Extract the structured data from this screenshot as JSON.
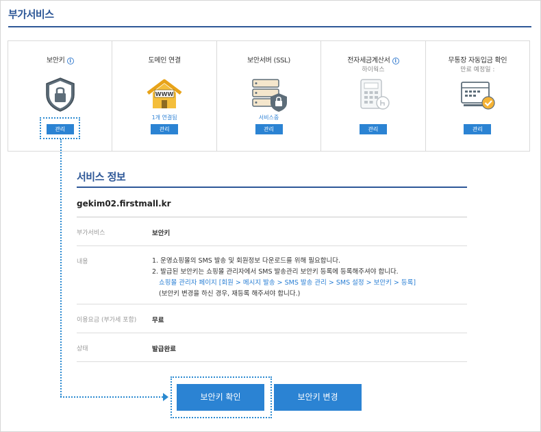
{
  "page": {
    "title": "부가서비스"
  },
  "cards": [
    {
      "title": "보안키",
      "info_icon": "i",
      "subtitle": "",
      "status": "",
      "icon": "shield-lock-icon",
      "button": "관리"
    },
    {
      "title": "도메인 연결",
      "subtitle": "",
      "status": "1개 연결됨",
      "icon": "www-house-icon",
      "button": "관리"
    },
    {
      "title": "보안서버 (SSL)",
      "subtitle": "",
      "status": "서비스중",
      "icon": "server-lock-icon",
      "button": "관리"
    },
    {
      "title": "전자세금계산서",
      "info_icon": "i",
      "subtitle": "하이웍스",
      "status": "",
      "icon": "calculator-icon",
      "button": "관리"
    },
    {
      "title": "무통장 자동입금 확인",
      "subtitle": "만료 예정일 :",
      "status": "",
      "icon": "card-check-icon",
      "button": "관리"
    }
  ],
  "service_info": {
    "title": "서비스 정보",
    "domain": "gekim02.firstmall.kr",
    "rows": {
      "addon": {
        "label": "부가서비스",
        "value": "보안키"
      },
      "content": {
        "label": "내용",
        "line1": "1. 운영쇼핑몰의 SMS 발송 및 회원정보 다운로드를 위해 필요합니다.",
        "line2": "2. 발급된 보안키는 쇼핑몰 관리자에서 SMS 발송관리 보안키 등록에 등록해주셔야 합니다.",
        "line3": "쇼핑몰 관리자 페이지 [회원 > 메시지 발송 > SMS 발송 관리 > SMS 설정 > 보안키 > 등록]",
        "line4": "(보안키 변경을 하신 경우, 재등록 해주셔야 합니다.)"
      },
      "fee": {
        "label": "이용요금 (부가세 포함)",
        "value": "무료"
      },
      "state": {
        "label": "상태",
        "value": "발급완료"
      }
    }
  },
  "buttons": {
    "confirm": "보안키 확인",
    "change": "보안키 변경"
  },
  "colors": {
    "accent": "#2b83d3",
    "heading": "#2d5797",
    "link": "#2a7fd4",
    "dotted": "#2a89d0"
  }
}
